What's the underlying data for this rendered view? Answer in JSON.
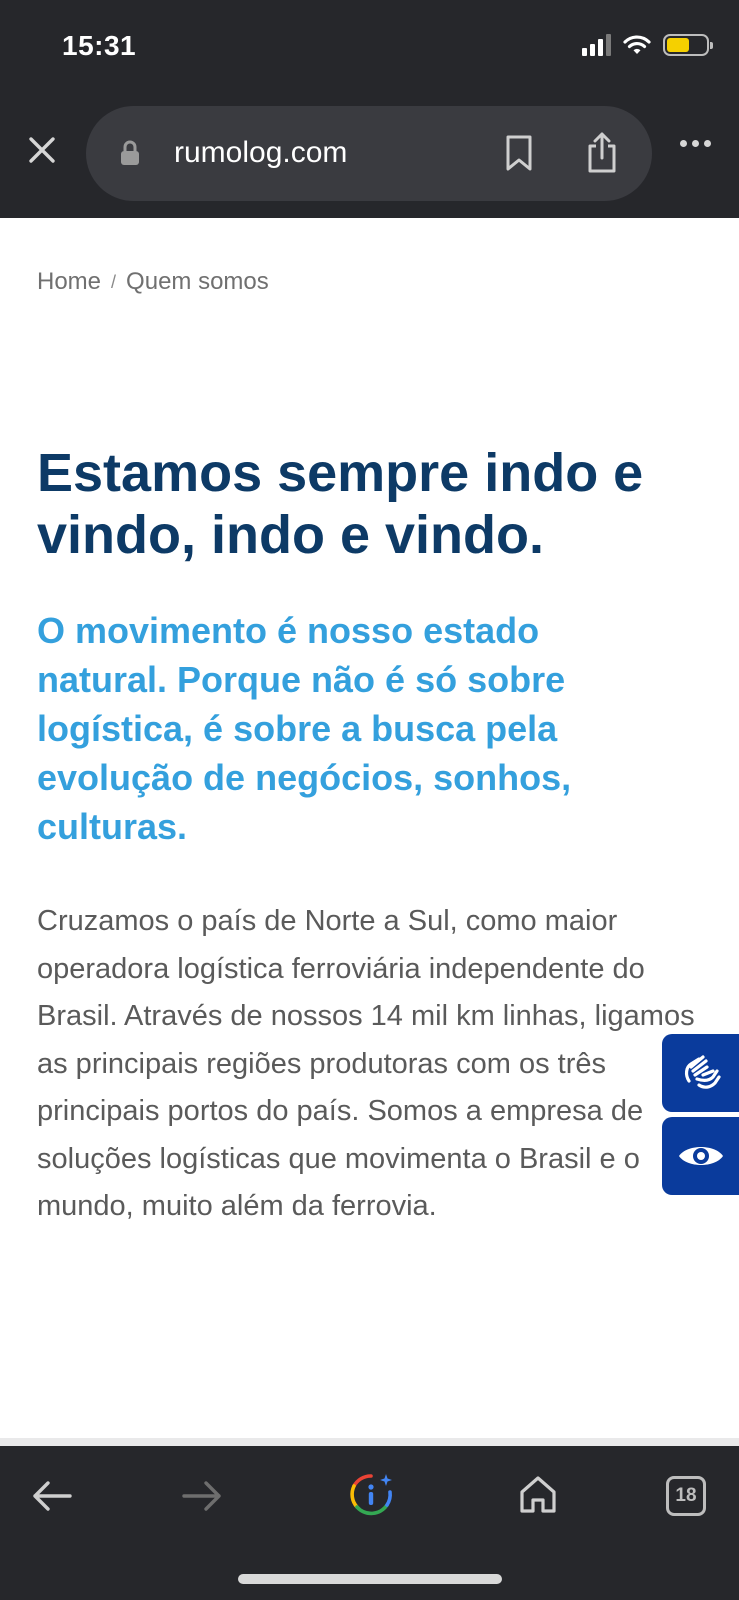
{
  "status_bar": {
    "time": "15:31"
  },
  "browser": {
    "url": "rumolog.com",
    "icons": [
      "close-icon",
      "lock-icon",
      "bookmark-icon",
      "share-icon",
      "more-icon"
    ]
  },
  "breadcrumb": {
    "home": "Home",
    "separator": "/",
    "current": "Quem somos"
  },
  "main": {
    "headline": "Estamos sempre indo e vindo, indo e vindo.",
    "subheadline": "O movimento é nosso estado natural. Porque não é só sobre logística, é sobre a busca pela evolução de negócios, sonhos, culturas.",
    "body": "Cruzamos o país de Norte a Sul, como maior operadora logística ferroviária independente do Brasil. Através de nossos 14 mil km linhas, ligamos as principais regiões produtoras com os três principais portos do país. Somos a empresa de soluções logísticas que movimenta o Brasil e o mundo, muito além da ferrovia."
  },
  "accessibility": {
    "icons": [
      "sign-language-icon",
      "eye-icon"
    ]
  },
  "toolbar": {
    "tab_count": "18",
    "icons": [
      "back-arrow-icon",
      "forward-arrow-icon",
      "assistant-icon",
      "home-icon",
      "tabs-icon"
    ]
  },
  "colors": {
    "headline": "#0d3a66",
    "subheadline": "#34a0dd",
    "body": "#5a5a5a",
    "chrome": "#26272b",
    "widget": "#0a3b9c"
  }
}
